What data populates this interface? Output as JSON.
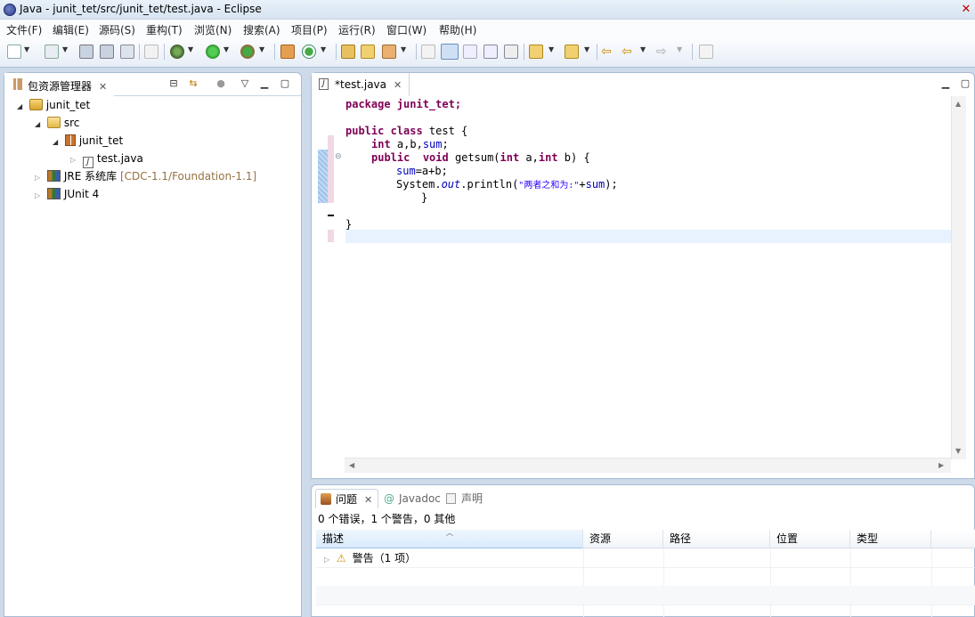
{
  "window": {
    "title": "Java - junit_tet/src/junit_tet/test.java - Eclipse"
  },
  "menu": [
    "文件(F)",
    "编辑(E)",
    "源码(S)",
    "重构(T)",
    "浏览(N)",
    "搜索(A)",
    "项目(P)",
    "运行(R)",
    "窗口(W)",
    "帮助(H)"
  ],
  "explorer": {
    "tab_label": "包资源管理器",
    "tree": [
      {
        "label": "junit_tet",
        "level": 0,
        "state": "expanded",
        "icon": "java-project-icon"
      },
      {
        "label": "src",
        "level": 1,
        "state": "expanded",
        "icon": "source-folder-icon"
      },
      {
        "label": "junit_tet",
        "level": 2,
        "state": "expanded",
        "icon": "package-icon"
      },
      {
        "label": "test.java",
        "level": 3,
        "state": "collapsed",
        "icon": "java-file-icon"
      },
      {
        "label": "JRE 系统库",
        "suffix": "[CDC-1.1/Foundation-1.1]",
        "level": 1,
        "state": "collapsed",
        "icon": "library-icon"
      },
      {
        "label": "JUnit 4",
        "level": 1,
        "state": "collapsed",
        "icon": "library-icon"
      }
    ]
  },
  "editor": {
    "tab_label": "*test.java",
    "code": {
      "l1": "package junit_tet;",
      "l2_kw": "public class",
      "l2_rest": " test {",
      "l3_kw": "int",
      "l3_rest": " a,b,",
      "l3_field": "sum",
      "l3_end": ";",
      "l4_kw1": "public",
      "l4_kw2": "void",
      "l4_a": " getsum(",
      "l4_kw3": "int",
      "l4_b": " a,",
      "l4_kw4": "int",
      "l4_c": " b) {",
      "l5_field": "sum",
      "l5_rest": "=a+b;",
      "l6_a": "System.",
      "l6_out": "out",
      "l6_b": ".println(",
      "l6_str": "\"两者之和为:\"",
      "l6_c": "+",
      "l6_field": "sum",
      "l6_d": ");",
      "l7": "}",
      "l9": "}"
    }
  },
  "problems": {
    "tabs": [
      "问题",
      "Javadoc",
      "声明"
    ],
    "summary": "0 个错误，1 个警告，0 其他",
    "columns": [
      "描述",
      "资源",
      "路径",
      "位置",
      "类型"
    ],
    "rows": [
      {
        "label": "警告（1 项）"
      }
    ]
  },
  "colors": {
    "keyword": "#7f0055",
    "field": "#0000c0",
    "string": "#2a00ff",
    "current_line": "#e8f2fe",
    "panel_border": "#a8bcd3"
  }
}
